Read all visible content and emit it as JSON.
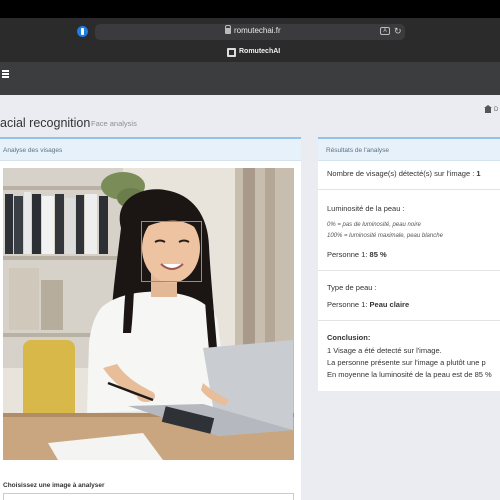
{
  "browser": {
    "url": "romutechai.fr",
    "tab_title": "RomutechAI"
  },
  "page": {
    "title": "acial recognition",
    "subtitle": "Face analysis",
    "breadcrumb": "D"
  },
  "left_panel": {
    "header": "Analyse des visages",
    "upload_label": "Choisissez une image à analyser"
  },
  "right_panel": {
    "header": "Résultats de l'analyse",
    "faces_label": "Nombre de visage(s) détecté(s) sur l'image : ",
    "faces_value": "1",
    "luminosity_title": "Luminosité de la peau :",
    "luminosity_note_0": "0% = pas de luminosité, peau noire",
    "luminosity_note_100": "100% = luminosité maximale, peau blanche",
    "person_label_1": "Personne 1: ",
    "luminosity_value": "85 %",
    "skin_type_title": "Type de peau :",
    "person_label_2": "Personne 1: ",
    "skin_type_value": "Peau claire",
    "conclusion_title": "Conclusion:",
    "conclusion_line1": "1 Visage a été detecté sur l'image.",
    "conclusion_line2": "La personne présente sur l'image a plutôt une p",
    "conclusion_line3": "En moyenne la luminosité de la peau est de 85 %"
  },
  "colors": {
    "accent_border": "#8ec5e9",
    "face_box": "#2fd22f"
  }
}
